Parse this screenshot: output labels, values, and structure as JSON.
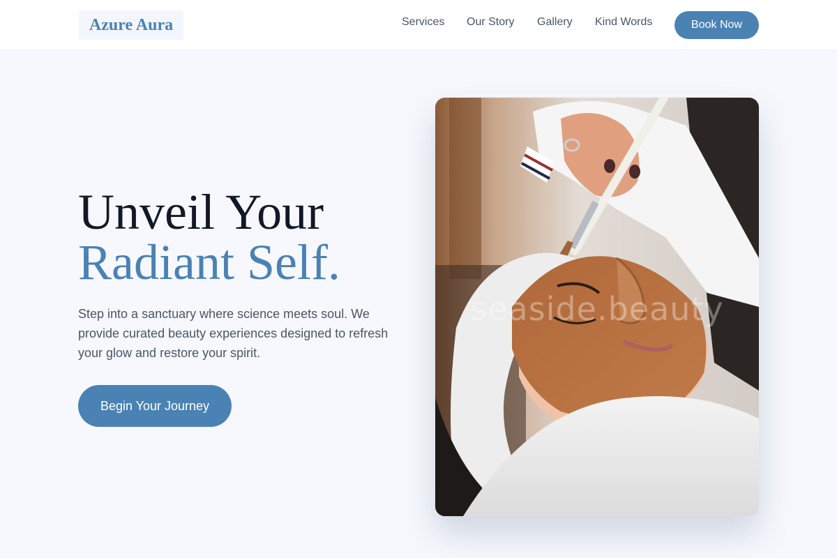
{
  "brand": {
    "name": "Azure Aura"
  },
  "nav": {
    "items": [
      {
        "label": "Services"
      },
      {
        "label": "Our Story"
      },
      {
        "label": "Gallery"
      },
      {
        "label": "Kind Words"
      }
    ],
    "cta_label": "Book Now"
  },
  "hero": {
    "headline_line1": "Unveil Your",
    "headline_line2": "Radiant Self.",
    "body": "Step into a sanctuary where science meets soul. We provide curated beauty experiences designed to refresh your glow and restore your spirit.",
    "cta_label": "Begin Your Journey",
    "image_watermark": "seaside.beauty"
  },
  "colors": {
    "accent": "#4a82b4",
    "page_background": "#f6f8fd",
    "heading": "#111827",
    "body_text": "#4a5568"
  }
}
